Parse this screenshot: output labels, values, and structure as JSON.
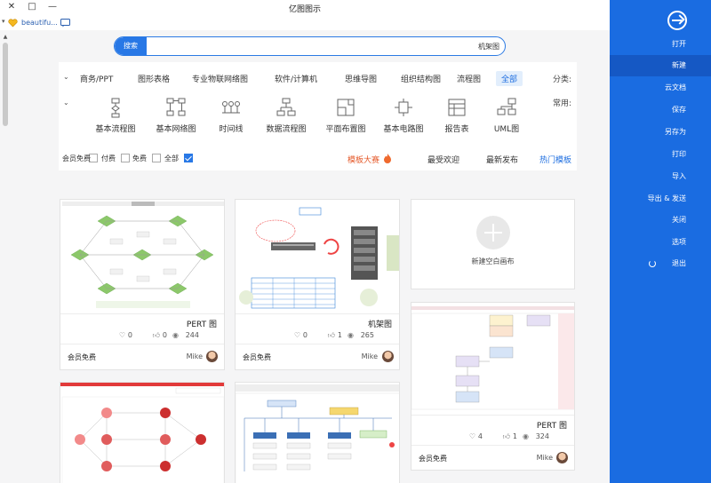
{
  "window": {
    "title": "亿图图示",
    "close": "✕",
    "maximize": "□",
    "minimize": "—"
  },
  "bookmarks": {
    "ext_label": "beautifu...",
    "arrow": "▾"
  },
  "search": {
    "button_label": "搜索",
    "query": "机架图"
  },
  "categories": {
    "label": "分类:",
    "items": [
      "全部",
      "流程图",
      "组织结构图",
      "思维导图",
      "软件/计算机",
      "专业物联网络图",
      "图形表格",
      "商务/PPT"
    ],
    "active_index": 0
  },
  "common": {
    "label": "常用:",
    "items": [
      "UML图",
      "报告表",
      "基本电路图",
      "平面布置图",
      "数据流程图",
      "时间线",
      "基本网络图",
      "基本流程图"
    ]
  },
  "filters": {
    "sort": [
      "热门模板",
      "最新发布",
      "最受欢迎"
    ],
    "contest": "模板大赛",
    "checkboxes": [
      {
        "label": "全部",
        "checked": true
      },
      {
        "label": "免费",
        "checked": false
      },
      {
        "label": "付费",
        "checked": false
      },
      {
        "label": "会员免费",
        "checked": false
      }
    ]
  },
  "new_blank": {
    "label": "新建空白画布"
  },
  "cards": [
    {
      "name": "机架图",
      "views": "265",
      "likes": "1",
      "favs": "0",
      "author": "Mike",
      "badge": "会员免费"
    },
    {
      "name": "PERT 图",
      "views": "244",
      "likes": "0",
      "favs": "0",
      "author": "Mike",
      "badge": "会员免费"
    },
    {
      "name": "PERT 图",
      "views": "324",
      "likes": "1",
      "favs": "4",
      "author": "Mike",
      "badge": "会员免费"
    }
  ],
  "sidebar": {
    "items": [
      "打开",
      "新建",
      "云文档",
      "保存",
      "另存为",
      "打印",
      "导入",
      "导出 & 发送",
      "关闭",
      "选项",
      "退出"
    ],
    "active_index": 1
  },
  "colors": {
    "accent": "#1a6ce1",
    "contest": "#e55a2b"
  }
}
